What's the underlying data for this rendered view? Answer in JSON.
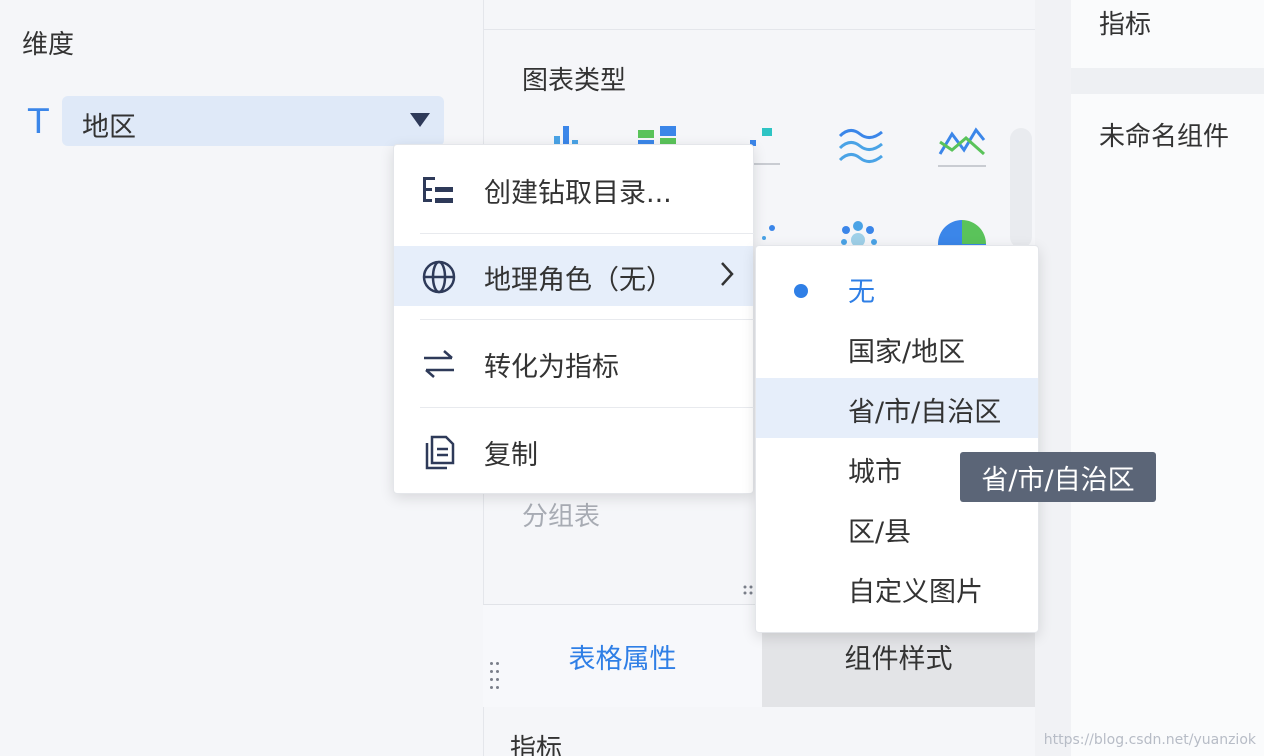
{
  "left_panel": {
    "title": "维度",
    "dimension_type_glyph": "T",
    "dimension_field": "地区"
  },
  "middle_panel": {
    "chart_type_title": "图表类型",
    "chart_type_caption": "分组表",
    "bottom_label": "指标",
    "tabs": [
      {
        "label": "表格属性",
        "active": true
      },
      {
        "label": "组件样式",
        "active": false
      }
    ]
  },
  "right_panel": {
    "top_label": "指标",
    "component_name": "未命名组件"
  },
  "context_menu": {
    "items": [
      {
        "label": "创建钻取目录...",
        "icon": "tree-list-icon"
      },
      {
        "label": "地理角色（无）",
        "icon": "globe-icon",
        "has_submenu": true
      },
      {
        "label": "转化为指标",
        "icon": "swap-arrows-icon"
      },
      {
        "label": "复制",
        "icon": "copy-icon"
      }
    ]
  },
  "geo_submenu": {
    "items": [
      {
        "label": "无",
        "selected": true
      },
      {
        "label": "国家/地区",
        "selected": false
      },
      {
        "label": "省/市/自治区",
        "selected": false,
        "hovered": true
      },
      {
        "label": "城市",
        "selected": false
      },
      {
        "label": "区/县",
        "selected": false
      },
      {
        "label": "自定义图片",
        "selected": false
      }
    ]
  },
  "tooltip": {
    "text": "省/市/自治区"
  },
  "watermark": "https://blog.csdn.net/yuanziok",
  "colors": {
    "accent": "#2f7fe6",
    "highlight": "#e6eefa",
    "tooltip_bg": "#5b6577"
  }
}
